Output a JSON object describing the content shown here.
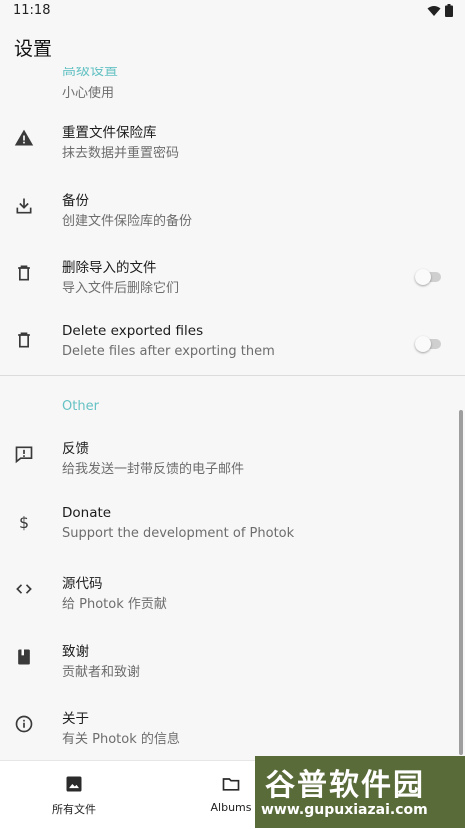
{
  "status": {
    "time": "11:18"
  },
  "header": {
    "title": "设置"
  },
  "cut_off_row": {
    "label": "高级设置",
    "sub": "小心使用"
  },
  "settings_rows": [
    {
      "title": "重置文件保险库",
      "sub": "抹去数据并重置密码",
      "icon": "warning-icon"
    },
    {
      "title": "备份",
      "sub": "创建文件保险库的备份",
      "icon": "download-icon"
    },
    {
      "title": "删除导入的文件",
      "sub": "导入文件后删除它们",
      "icon": "trash-icon"
    },
    {
      "title": "Delete exported files",
      "sub": "Delete files after exporting them",
      "icon": "trash-icon"
    }
  ],
  "other_section": {
    "header": "Other"
  },
  "other_rows": [
    {
      "title": "反馈",
      "sub": "给我发送一封带反馈的电子邮件",
      "icon": "feedback-icon"
    },
    {
      "title": "Donate",
      "sub": "Support the development of Photok",
      "icon": "dollar-icon"
    },
    {
      "title": "源代码",
      "sub": "给 Photok 作贡献",
      "icon": "code-icon"
    },
    {
      "title": "致谢",
      "sub": "贡献者和致谢",
      "icon": "book-icon"
    },
    {
      "title": "关于",
      "sub": "有关 Photok 的信息",
      "icon": "info-icon"
    }
  ],
  "bottom_nav": [
    {
      "label": "所有文件",
      "icon": "image-icon"
    },
    {
      "label": "Albums",
      "icon": "folder-icon"
    }
  ],
  "watermark": {
    "title": "谷普软件园",
    "url": "www.gupuxiazai.com"
  },
  "colors": {
    "accent": "#66c2c4",
    "icon": "#3a3a3a",
    "background": "#f7f7f7"
  }
}
